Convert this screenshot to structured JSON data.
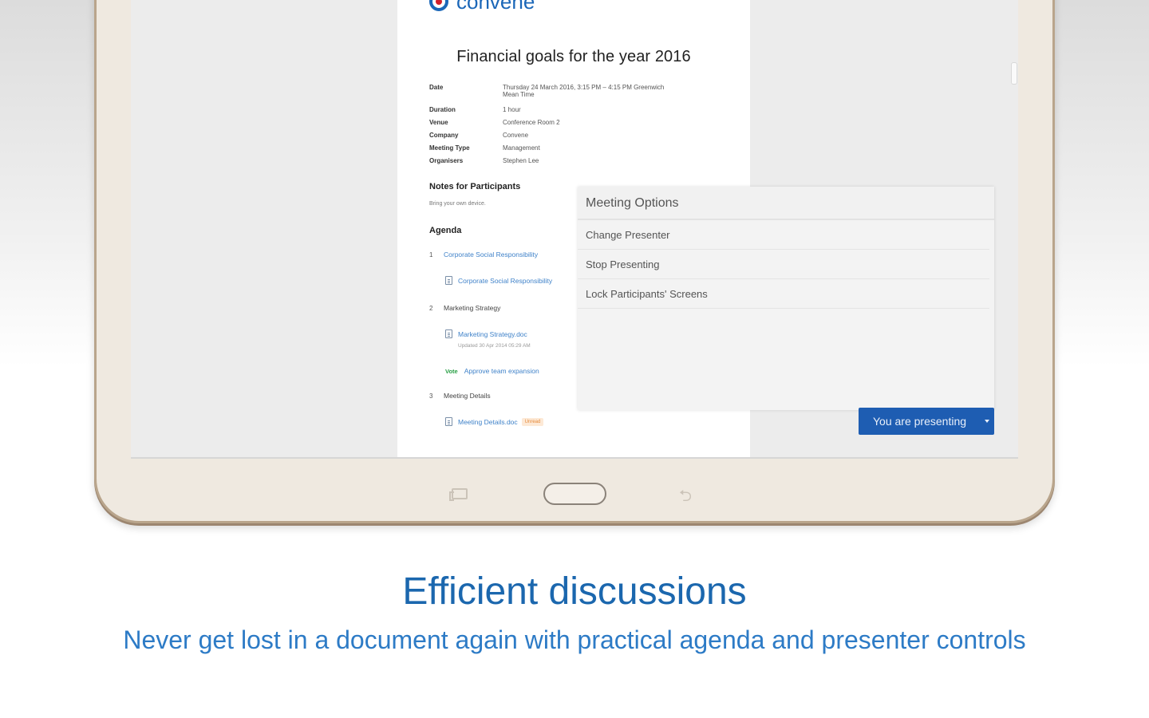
{
  "document": {
    "logo_text": "convene",
    "title": "Financial goals for the year 2016",
    "meta": [
      {
        "key": "Date",
        "value": "Thursday 24 March 2016, 3:15 PM – 4:15 PM Greenwich",
        "value2": "Mean Time"
      },
      {
        "key": "Duration",
        "value": "1 hour"
      },
      {
        "key": "Venue",
        "value": "Conference Room 2"
      },
      {
        "key": "Company",
        "value": "Convene"
      },
      {
        "key": "Meeting Type",
        "value": "Management"
      },
      {
        "key": "Organisers",
        "value": "Stephen Lee"
      }
    ],
    "notes_heading": "Notes for Participants",
    "notes_text": "Bring your own device.",
    "agenda_heading": "Agenda",
    "agenda": [
      {
        "num": "1",
        "title": "Corporate Social Responsibility",
        "file": "Corporate Social Responsibility"
      },
      {
        "num": "2",
        "title": "Marketing Strategy",
        "file": "Marketing Strategy.doc",
        "file_sub": "Updated 30 Apr 2014 05:29 AM",
        "vote_badge": "Vote",
        "vote_text": "Approve team expansion"
      },
      {
        "num": "3",
        "title": "Meeting Details",
        "file": "Meeting Details.doc",
        "tag": "Unread"
      }
    ]
  },
  "options_panel": {
    "title": "Meeting Options",
    "items": [
      "Change Presenter",
      "Stop Presenting",
      "Lock Participants' Screens"
    ]
  },
  "present_button": {
    "label": "You are presenting"
  },
  "caption": {
    "headline": "Efficient discussions",
    "subline": "Never get lost in a document again with practical agenda and presenter controls"
  },
  "colors": {
    "accent": "#1e5db2",
    "headline": "#1b67ae",
    "link": "#3f82c9"
  },
  "icons": [
    "file-icon",
    "recent-apps-icon",
    "home-button",
    "back-icon",
    "caret-down-icon"
  ]
}
